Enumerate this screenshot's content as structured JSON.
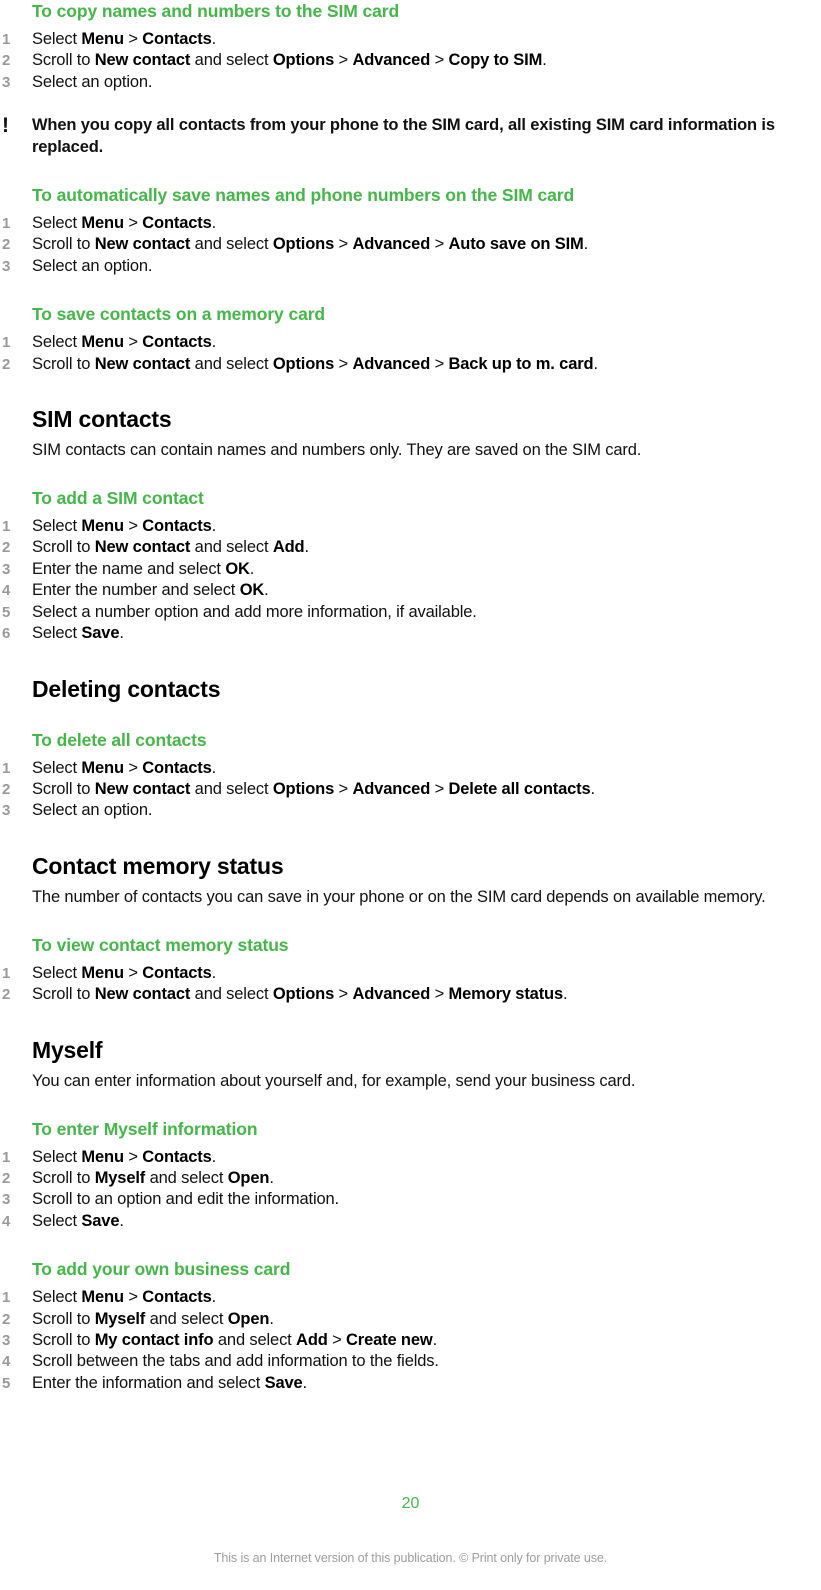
{
  "document": {
    "page_number": "20",
    "footer": "This is an Internet version of this publication. © Print only for private use.",
    "accent_green": "#45b649",
    "number_gray": "#9a9a9a",
    "footer_gray": "#9d9d9d",
    "body_black": "#111111"
  },
  "blocks": [
    {
      "kind": "procedure",
      "title": "To copy names and numbers to the SIM card",
      "steps": [
        {
          "num": "1",
          "parts": [
            {
              "t": "Select ",
              "b": false
            },
            {
              "t": "Menu",
              "b": true
            },
            {
              "t": " > ",
              "b": false
            },
            {
              "t": "Contacts",
              "b": true
            },
            {
              "t": ".",
              "b": false
            }
          ]
        },
        {
          "num": "2",
          "parts": [
            {
              "t": "Scroll to ",
              "b": false
            },
            {
              "t": "New contact",
              "b": true
            },
            {
              "t": " and select ",
              "b": false
            },
            {
              "t": "Options",
              "b": true
            },
            {
              "t": " > ",
              "b": false
            },
            {
              "t": "Advanced",
              "b": true
            },
            {
              "t": " > ",
              "b": false
            },
            {
              "t": "Copy to SIM",
              "b": true
            },
            {
              "t": ".",
              "b": false
            }
          ]
        },
        {
          "num": "3",
          "parts": [
            {
              "t": "Select an option.",
              "b": false
            }
          ]
        }
      ]
    },
    {
      "kind": "note",
      "icon": "exclamation-icon",
      "text": "When you copy all contacts from your phone to the SIM card, all existing SIM card information is replaced."
    },
    {
      "kind": "procedure",
      "title": "To automatically save names and phone numbers on the SIM card",
      "steps": [
        {
          "num": "1",
          "parts": [
            {
              "t": "Select ",
              "b": false
            },
            {
              "t": "Menu",
              "b": true
            },
            {
              "t": " > ",
              "b": false
            },
            {
              "t": "Contacts",
              "b": true
            },
            {
              "t": ".",
              "b": false
            }
          ]
        },
        {
          "num": "2",
          "parts": [
            {
              "t": "Scroll to ",
              "b": false
            },
            {
              "t": "New contact",
              "b": true
            },
            {
              "t": " and select ",
              "b": false
            },
            {
              "t": "Options",
              "b": true
            },
            {
              "t": " > ",
              "b": false
            },
            {
              "t": "Advanced",
              "b": true
            },
            {
              "t": " > ",
              "b": false
            },
            {
              "t": "Auto save on SIM",
              "b": true
            },
            {
              "t": ".",
              "b": false
            }
          ]
        },
        {
          "num": "3",
          "parts": [
            {
              "t": "Select an option.",
              "b": false
            }
          ]
        }
      ]
    },
    {
      "kind": "procedure",
      "title": "To save contacts on a memory card",
      "steps": [
        {
          "num": "1",
          "parts": [
            {
              "t": "Select ",
              "b": false
            },
            {
              "t": "Menu",
              "b": true
            },
            {
              "t": " > ",
              "b": false
            },
            {
              "t": "Contacts",
              "b": true
            },
            {
              "t": ".",
              "b": false
            }
          ]
        },
        {
          "num": "2",
          "parts": [
            {
              "t": "Scroll to ",
              "b": false
            },
            {
              "t": "New contact",
              "b": true
            },
            {
              "t": " and select ",
              "b": false
            },
            {
              "t": "Options",
              "b": true
            },
            {
              "t": " > ",
              "b": false
            },
            {
              "t": "Advanced",
              "b": true
            },
            {
              "t": " > ",
              "b": false
            },
            {
              "t": "Back up to m. card",
              "b": true
            },
            {
              "t": ".",
              "b": false
            }
          ]
        }
      ]
    },
    {
      "kind": "section",
      "title": "SIM contacts",
      "intro": "SIM contacts can contain names and numbers only. They are saved on the SIM card."
    },
    {
      "kind": "procedure",
      "title": "To add a SIM contact",
      "steps": [
        {
          "num": "1",
          "parts": [
            {
              "t": "Select ",
              "b": false
            },
            {
              "t": "Menu",
              "b": true
            },
            {
              "t": " > ",
              "b": false
            },
            {
              "t": "Contacts",
              "b": true
            },
            {
              "t": ".",
              "b": false
            }
          ]
        },
        {
          "num": "2",
          "parts": [
            {
              "t": "Scroll to ",
              "b": false
            },
            {
              "t": "New contact",
              "b": true
            },
            {
              "t": " and select ",
              "b": false
            },
            {
              "t": "Add",
              "b": true
            },
            {
              "t": ".",
              "b": false
            }
          ]
        },
        {
          "num": "3",
          "parts": [
            {
              "t": "Enter the name and select ",
              "b": false
            },
            {
              "t": "OK",
              "b": true
            },
            {
              "t": ".",
              "b": false
            }
          ]
        },
        {
          "num": "4",
          "parts": [
            {
              "t": "Enter the number and select ",
              "b": false
            },
            {
              "t": "OK",
              "b": true
            },
            {
              "t": ".",
              "b": false
            }
          ]
        },
        {
          "num": "5",
          "parts": [
            {
              "t": "Select a number option and add more information, if available.",
              "b": false
            }
          ]
        },
        {
          "num": "6",
          "parts": [
            {
              "t": "Select ",
              "b": false
            },
            {
              "t": "Save",
              "b": true
            },
            {
              "t": ".",
              "b": false
            }
          ]
        }
      ]
    },
    {
      "kind": "section",
      "title": "Deleting contacts",
      "intro": ""
    },
    {
      "kind": "procedure",
      "title": "To delete all contacts",
      "steps": [
        {
          "num": "1",
          "parts": [
            {
              "t": "Select ",
              "b": false
            },
            {
              "t": "Menu",
              "b": true
            },
            {
              "t": " > ",
              "b": false
            },
            {
              "t": "Contacts",
              "b": true
            },
            {
              "t": ".",
              "b": false
            }
          ]
        },
        {
          "num": "2",
          "parts": [
            {
              "t": "Scroll to ",
              "b": false
            },
            {
              "t": "New contact",
              "b": true
            },
            {
              "t": " and select ",
              "b": false
            },
            {
              "t": "Options",
              "b": true
            },
            {
              "t": " > ",
              "b": false
            },
            {
              "t": "Advanced",
              "b": true
            },
            {
              "t": " > ",
              "b": false
            },
            {
              "t": "Delete all contacts",
              "b": true
            },
            {
              "t": ".",
              "b": false
            }
          ]
        },
        {
          "num": "3",
          "parts": [
            {
              "t": "Select an option.",
              "b": false
            }
          ]
        }
      ]
    },
    {
      "kind": "section",
      "title": "Contact memory status",
      "intro": "The number of contacts you can save in your phone or on the SIM card depends on available memory."
    },
    {
      "kind": "procedure",
      "title": "To view contact memory status",
      "steps": [
        {
          "num": "1",
          "parts": [
            {
              "t": "Select ",
              "b": false
            },
            {
              "t": "Menu",
              "b": true
            },
            {
              "t": " > ",
              "b": false
            },
            {
              "t": "Contacts",
              "b": true
            },
            {
              "t": ".",
              "b": false
            }
          ]
        },
        {
          "num": "2",
          "parts": [
            {
              "t": "Scroll to ",
              "b": false
            },
            {
              "t": "New contact",
              "b": true
            },
            {
              "t": " and select ",
              "b": false
            },
            {
              "t": "Options",
              "b": true
            },
            {
              "t": " > ",
              "b": false
            },
            {
              "t": "Advanced",
              "b": true
            },
            {
              "t": " > ",
              "b": false
            },
            {
              "t": "Memory status",
              "b": true
            },
            {
              "t": ".",
              "b": false
            }
          ]
        }
      ]
    },
    {
      "kind": "section",
      "title": "Myself",
      "intro": "You can enter information about yourself and, for example, send your business card."
    },
    {
      "kind": "procedure",
      "title": "To enter Myself information",
      "steps": [
        {
          "num": "1",
          "parts": [
            {
              "t": "Select ",
              "b": false
            },
            {
              "t": "Menu",
              "b": true
            },
            {
              "t": " > ",
              "b": false
            },
            {
              "t": "Contacts",
              "b": true
            },
            {
              "t": ".",
              "b": false
            }
          ]
        },
        {
          "num": "2",
          "parts": [
            {
              "t": "Scroll to ",
              "b": false
            },
            {
              "t": "Myself",
              "b": true
            },
            {
              "t": " and select ",
              "b": false
            },
            {
              "t": "Open",
              "b": true
            },
            {
              "t": ".",
              "b": false
            }
          ]
        },
        {
          "num": "3",
          "parts": [
            {
              "t": "Scroll to an option and edit the information.",
              "b": false
            }
          ]
        },
        {
          "num": "4",
          "parts": [
            {
              "t": "Select ",
              "b": false
            },
            {
              "t": "Save",
              "b": true
            },
            {
              "t": ".",
              "b": false
            }
          ]
        }
      ]
    },
    {
      "kind": "procedure",
      "title": "To add your own business card",
      "steps": [
        {
          "num": "1",
          "parts": [
            {
              "t": "Select ",
              "b": false
            },
            {
              "t": "Menu",
              "b": true
            },
            {
              "t": " > ",
              "b": false
            },
            {
              "t": "Contacts",
              "b": true
            },
            {
              "t": ".",
              "b": false
            }
          ]
        },
        {
          "num": "2",
          "parts": [
            {
              "t": "Scroll to ",
              "b": false
            },
            {
              "t": "Myself",
              "b": true
            },
            {
              "t": " and select ",
              "b": false
            },
            {
              "t": "Open",
              "b": true
            },
            {
              "t": ".",
              "b": false
            }
          ]
        },
        {
          "num": "3",
          "parts": [
            {
              "t": "Scroll to ",
              "b": false
            },
            {
              "t": "My contact info",
              "b": true
            },
            {
              "t": " and select ",
              "b": false
            },
            {
              "t": "Add",
              "b": true
            },
            {
              "t": " > ",
              "b": false
            },
            {
              "t": "Create new",
              "b": true
            },
            {
              "t": ".",
              "b": false
            }
          ]
        },
        {
          "num": "4",
          "parts": [
            {
              "t": "Scroll between the tabs and add information to the fields.",
              "b": false
            }
          ]
        },
        {
          "num": "5",
          "parts": [
            {
              "t": "Enter the information and select ",
              "b": false
            },
            {
              "t": "Save",
              "b": true
            },
            {
              "t": ".",
              "b": false
            }
          ]
        }
      ]
    }
  ]
}
